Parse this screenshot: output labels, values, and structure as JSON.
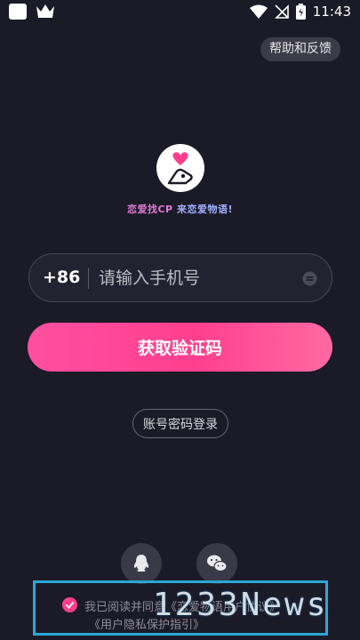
{
  "status_bar": {
    "time": "11:43",
    "icons": [
      "app-square-icon",
      "crown-icon",
      "wifi-icon",
      "no-sim-icon",
      "battery-icon"
    ]
  },
  "header": {
    "help_label": "帮助和反馈"
  },
  "brand": {
    "slogan_part1": "恋爱找CP",
    "slogan_part2": "来恋爱物语!"
  },
  "login": {
    "country_code": "+86",
    "phone_placeholder": "请输入手机号",
    "get_code_label": "获取验证码",
    "password_login_label": "账号密码登录"
  },
  "social": {
    "icons": [
      "qq-icon",
      "wechat-icon"
    ]
  },
  "agreement": {
    "line1": "我已阅读并同意《恋爱物语用户协议》",
    "line2": "《用户隐私保护指引》",
    "checked": true
  },
  "watermark": {
    "text": "1233News"
  },
  "colors": {
    "background": "#1b1a27",
    "accent": "#ff3f8e",
    "slogan_pink": "#e07ad6",
    "slogan_blue": "#9fb0ff"
  }
}
